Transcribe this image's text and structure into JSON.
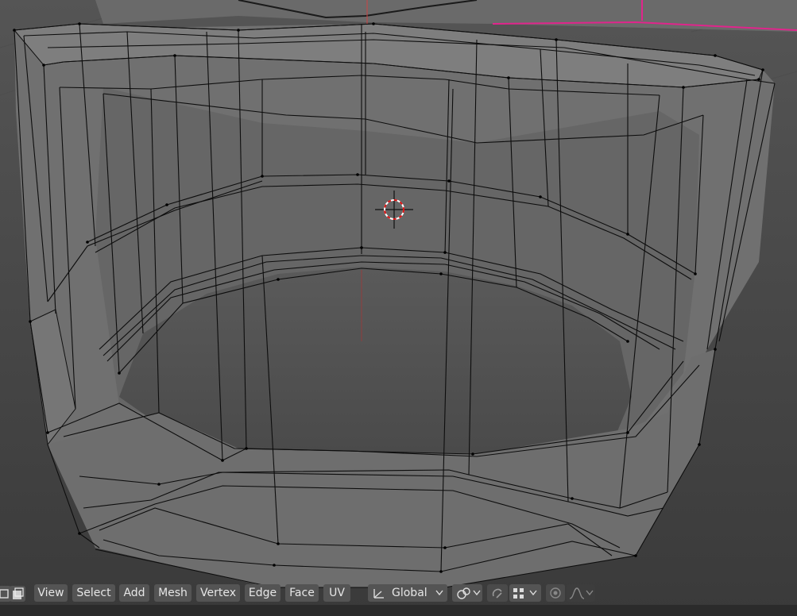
{
  "header": {
    "menus": [
      {
        "label": "View",
        "name": "menu-view"
      },
      {
        "label": "Select",
        "name": "menu-select"
      },
      {
        "label": "Add",
        "name": "menu-add"
      },
      {
        "label": "Mesh",
        "name": "menu-mesh"
      },
      {
        "label": "Vertex",
        "name": "menu-vertex"
      },
      {
        "label": "Edge",
        "name": "menu-edge"
      },
      {
        "label": "Face",
        "name": "menu-face"
      },
      {
        "label": "UV",
        "name": "menu-uv"
      }
    ],
    "transform_orientation": "Global",
    "icons": {
      "orientation": "transform-orientation-icon",
      "pivot": "pivot-point-icon",
      "snap_toggle": "snap-toggle-icon",
      "snap_target": "snap-increment-icon",
      "proportional": "proportional-editing-icon",
      "falloff": "falloff-smooth-icon",
      "mode_vertex": "vertex-select-mode-icon",
      "mode_face": "face-select-mode-icon",
      "cursor": "3d-cursor-icon"
    }
  },
  "colors": {
    "viewport_bg": "#3d3d3d",
    "mesh_face": "#7a7a7a",
    "wire": "#000000",
    "selected_edge": "#e0258c",
    "header_button": "#545454",
    "header_text": "#e6e6e6"
  }
}
